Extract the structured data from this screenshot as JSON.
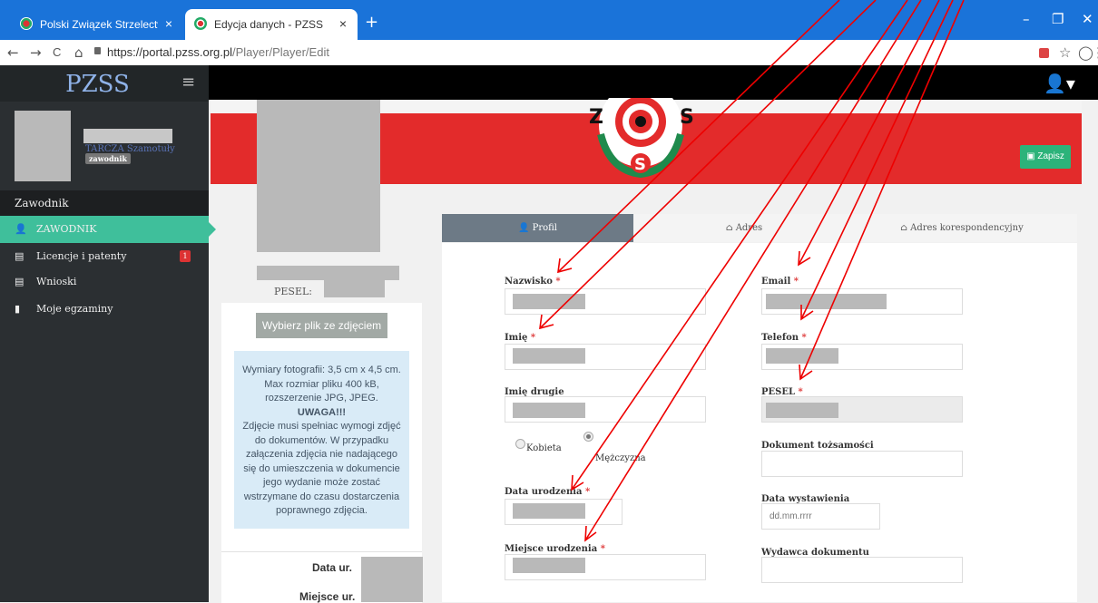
{
  "browser": {
    "tabs": [
      {
        "title": "Polski Związek Strzelectwa Sport",
        "close": "×"
      },
      {
        "title": "Edycja danych - PZSS",
        "close": "×"
      }
    ],
    "new_tab": "+",
    "url_domain": "https://portal.pzss.org.pl",
    "url_path": "/Player/Player/Edit",
    "window_controls": [
      "–",
      "❐",
      "✕"
    ],
    "nav": [
      "←",
      "→",
      "C",
      "⌂"
    ],
    "toolbar_icons": [
      "☆",
      "◯",
      "⋮"
    ]
  },
  "sidebar": {
    "brand": "PZSS",
    "club": "TARCZA Szamotuły",
    "role": "zawodnik",
    "section": "Zawodnik",
    "items": [
      {
        "label": "ZAWODNIK",
        "icon": "user-icon"
      },
      {
        "label": "Licencje i patenty",
        "icon": "id-card-icon",
        "badge": "1"
      },
      {
        "label": "Wnioski",
        "icon": "id-card-icon"
      },
      {
        "label": "Moje egzaminy",
        "icon": "book-icon"
      }
    ]
  },
  "header": {
    "save_label": "Zapisz"
  },
  "photo": {
    "pesel_label": "PESEL:",
    "choose_label": "Wybierz plik ze zdjęciem",
    "info_1": "Wymiary fotografii: 3,5 cm x 4,5 cm. Max rozmiar pliku 400 kB, rozszerzenie JPG, JPEG.",
    "info_warn": "UWAGA!!!",
    "info_2": "Zdjęcie musi spełniac wymogi zdjęć do dokumentów. W przypadku załączenia zdjęcia nie nadającego się do umieszczenia w dokumencie jego wydanie może zostać wstrzymane do czasu dostarczenia poprawnego zdjęcia.",
    "birth_label": "Data ur.",
    "place_label": "Miejsce ur."
  },
  "form": {
    "tabs": [
      "Profil",
      "Adres",
      "Adres korespondencyjny"
    ],
    "required_mark": "*",
    "nazwisko": "Nazwisko",
    "imie": "Imię",
    "imie_drugie": "Imię drugie",
    "kobieta": "Kobieta",
    "mezczyzna": "Mężczyzna",
    "data_urodzenia": "Data urodzenia",
    "miejsce_urodzenia": "Miejsce urodzenia",
    "email": "Email",
    "telefon": "Telefon",
    "pesel": "PESEL",
    "dokument": "Dokument tożsamości",
    "data_wystawienia": "Data wystawienia",
    "data_wystawienia_placeholder": "dd.mm.rrrr",
    "wydawca": "Wydawca dokumentu"
  }
}
